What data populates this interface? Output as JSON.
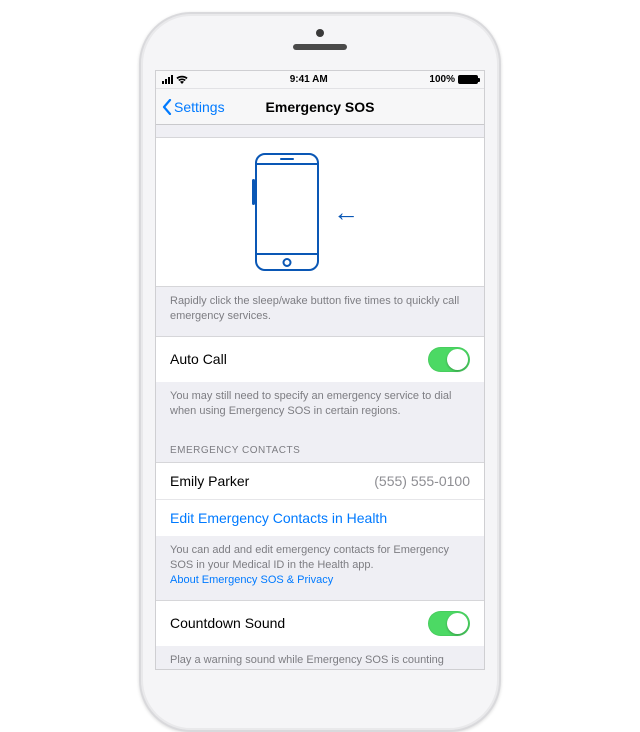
{
  "status": {
    "time": "9:41 AM",
    "battery_pct": "100%"
  },
  "nav": {
    "back": "Settings",
    "title": "Emergency SOS"
  },
  "illus_footer": "Rapidly click the sleep/wake button five times to quickly call emergency services.",
  "auto_call": {
    "label": "Auto Call",
    "footer": "You may still need to specify an emergency service to dial when using Emergency SOS in certain regions."
  },
  "contacts": {
    "header": "EMERGENCY CONTACTS",
    "name": "Emily Parker",
    "number": "(555) 555-0100",
    "edit": "Edit Emergency Contacts in Health",
    "footer_text": "You can add and edit emergency contacts for Emergency SOS in your Medical ID in the Health app.",
    "footer_link": "About Emergency SOS & Privacy"
  },
  "countdown": {
    "label": "Countdown Sound",
    "footer": "Play a warning sound while Emergency SOS is counting down"
  }
}
